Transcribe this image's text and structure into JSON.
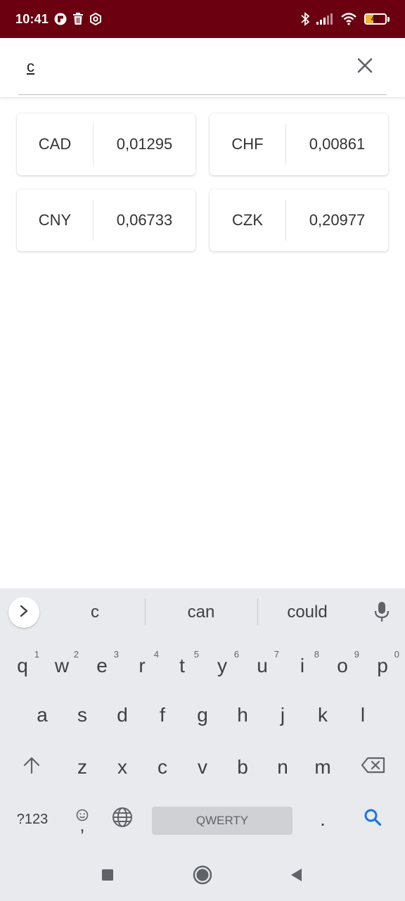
{
  "status_bar": {
    "time": "10:41",
    "battery": "41",
    "battery_level": 0.41,
    "colors": {
      "background": "#6b0010",
      "battery_fill": "#f2b233"
    },
    "icons": [
      "flipboard-icon",
      "trash-icon",
      "settings-hex-icon",
      "bluetooth-icon",
      "signal-icon",
      "wifi-icon",
      "battery-icon"
    ]
  },
  "search": {
    "value": "c",
    "icons": [
      "close-icon"
    ]
  },
  "currencies": [
    {
      "code": "CAD",
      "rate": "0,01295"
    },
    {
      "code": "CHF",
      "rate": "0,00861"
    },
    {
      "code": "CNY",
      "rate": "0,06733"
    },
    {
      "code": "CZK",
      "rate": "0,20977"
    }
  ],
  "keyboard": {
    "suggestions": [
      "c",
      "can",
      "could"
    ],
    "row1": [
      {
        "letter": "q",
        "num": "1"
      },
      {
        "letter": "w",
        "num": "2"
      },
      {
        "letter": "e",
        "num": "3"
      },
      {
        "letter": "r",
        "num": "4"
      },
      {
        "letter": "t",
        "num": "5"
      },
      {
        "letter": "y",
        "num": "6"
      },
      {
        "letter": "u",
        "num": "7"
      },
      {
        "letter": "i",
        "num": "8"
      },
      {
        "letter": "o",
        "num": "9"
      },
      {
        "letter": "p",
        "num": "0"
      }
    ],
    "row2": [
      "a",
      "s",
      "d",
      "f",
      "g",
      "h",
      "j",
      "k",
      "l"
    ],
    "row3": [
      "z",
      "x",
      "c",
      "v",
      "b",
      "n",
      "m"
    ],
    "symbols_key": "?123",
    "comma_key": ",",
    "period_key": ".",
    "space_label": "QWERTY",
    "accent_color": "#1a73e8",
    "icons": [
      "chevron-right-icon",
      "mic-icon",
      "shift-icon",
      "backspace-icon",
      "emoji-icon",
      "globe-icon",
      "search-icon"
    ]
  },
  "nav_bar": {
    "icons": [
      "recents-square-icon",
      "home-circle-icon",
      "back-triangle-icon"
    ]
  }
}
